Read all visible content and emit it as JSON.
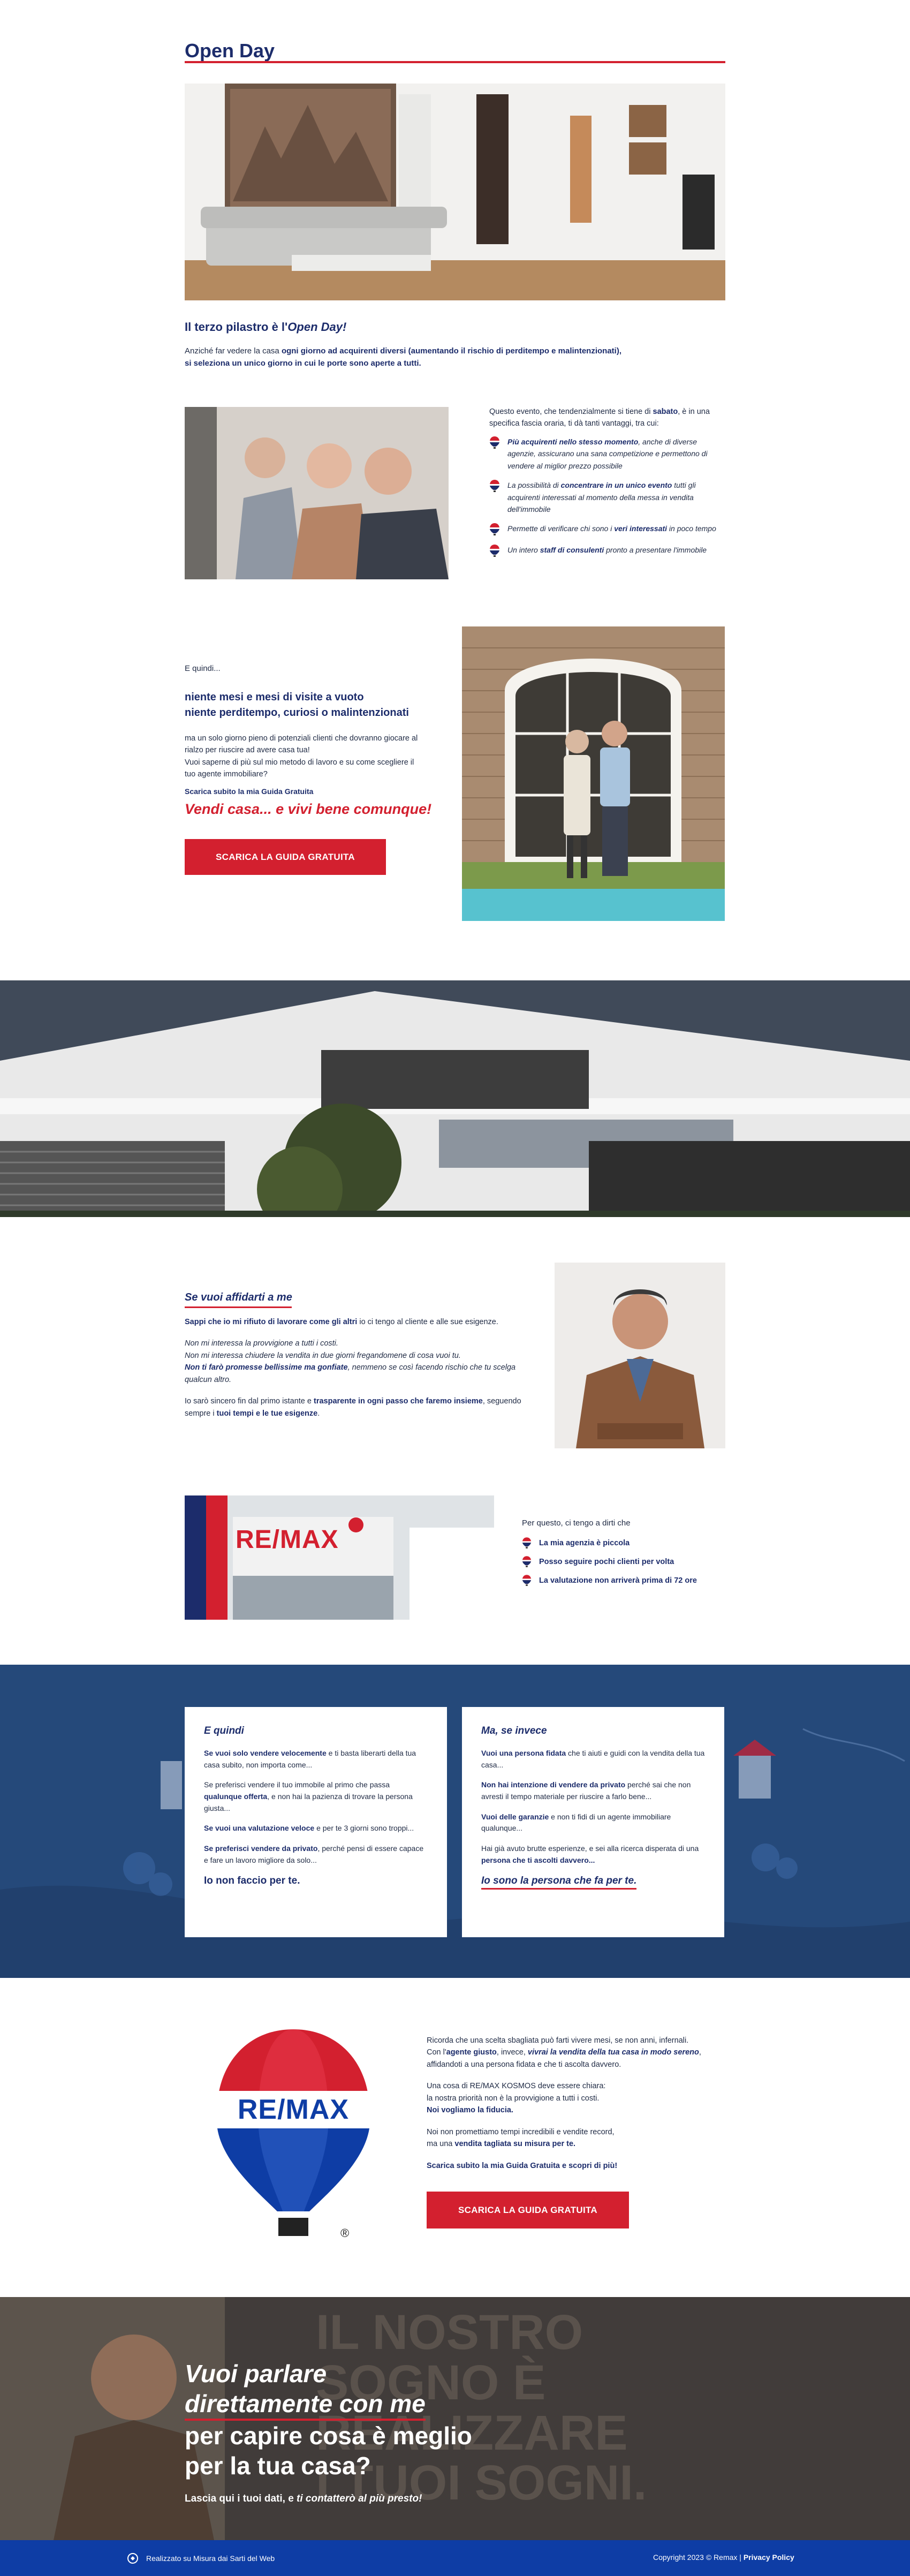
{
  "open_day": {
    "title": "Open Day",
    "pillar_title_a": "Il terzo pilastro è l'",
    "pillar_title_b": "Open Day!",
    "pillar_text_a": "Anziché far vedere la casa ",
    "pillar_text_b": "ogni giorno ad acquirenti diversi (aumentando il rischio di perditempo e malintenzionati),",
    "pillar_text_c": "si seleziona un unico giorno in cui le porte sono aperte a tutti."
  },
  "advantages": {
    "intro_a": "Questo evento, che tendenzialmente si tiene di ",
    "intro_b": "sabato",
    "intro_c": ", è in una specifica fascia oraria, ti dà tanti vantaggi, tra cui:",
    "items": [
      {
        "strong": "Più acquirenti nello stesso momento",
        "rest": ", anche di diverse agenzie, assicurano una sana competizione e permettono di vendere al miglior prezzo possibile"
      },
      {
        "lead": "La possibilità di ",
        "strong": "concentrare in un unico evento",
        "rest": " tutti gli acquirenti interessati al momento della messa in vendita dell'immobile"
      },
      {
        "lead": "Permette di verificare chi sono i ",
        "strong": "veri interessati",
        "rest": " in poco tempo"
      },
      {
        "lead": "Un intero ",
        "strong": "staff di consulenti",
        "rest": " pronto a presentare l'immobile"
      }
    ]
  },
  "months": {
    "quindi": "E quindi...",
    "head_1": "niente mesi e mesi di visite a vuoto",
    "head_2": "niente perditempo, curiosi o malintenzionati",
    "body_1": "ma un solo giorno pieno di potenziali clienti che dovranno giocare al rialzo per riuscire ad avere casa tua!",
    "body_2": "Vuoi saperne di più sul mio metodo di lavoro e su come scegliere il tuo agente immobiliare?",
    "download_note": "Scarica subito la mia Guida Gratuita",
    "slogan": "Vendi casa... e vivi bene comunque!",
    "button": "SCARICA LA GUIDA GRATUITA"
  },
  "affidarti": {
    "title": "Se vuoi affidarti a me",
    "p1_a": "Sappi che io mi rifiuto di lavorare come gli altri",
    "p1_b": " io ci tengo al cliente e alle sue esigenze.",
    "p2_1": "Non mi interessa la provvigione a tutti i costi.",
    "p2_2": "Non mi interessa chiudere la vendita in due giorni fregandomene di cosa vuoi tu.",
    "p2_3a": "Non ti farò promesse bellissime ma gonfiate",
    "p2_3b": ", nemmeno se così facendo rischio che tu scelga qualcun altro.",
    "p3_a": "Io sarò sincero fin dal primo istante e ",
    "p3_b": "trasparente in ogni passo che faremo insieme",
    "p3_c": ", seguendo sempre i ",
    "p3_d": "tuoi tempi e le tue esigenze",
    "p3_e": "."
  },
  "remax_row": {
    "sign": "RE/MAX",
    "intro": "Per questo, ci tengo a dirti che",
    "items": [
      "La mia agenzia è piccola",
      "Posso seguire pochi clienti per volta",
      "La valutazione non arriverà prima di 72 ore"
    ]
  },
  "cards": {
    "left": {
      "title": "E quindi",
      "p1_a": "Se vuoi solo vendere velocemente",
      "p1_b": " e ti basta liberarti della tua casa subito, non importa come...",
      "p2_a": "Se preferisci vendere il tuo immobile al primo che passa ",
      "p2_b": "qualunque offerta",
      "p2_c": ", e non hai la pazienza di trovare la persona giusta...",
      "p3_a": "Se vuoi una valutazione veloce",
      "p3_b": " e per te 3 giorni sono troppi...",
      "p4_a": "Se preferisci vendere da privato",
      "p4_b": ", perché pensi di essere capace e fare un lavoro migliore da solo...",
      "final": "Io non faccio per te."
    },
    "right": {
      "title": "Ma, se invece",
      "p1_a": "Vuoi una persona fidata",
      "p1_b": " che ti aiuti e guidi con la vendita della tua casa...",
      "p2_a": "Non hai intenzione di vendere da privato",
      "p2_b": " perché sai che non avresti il tempo materiale per riuscire a farlo bene...",
      "p3_a": "Vuoi delle garanzie",
      "p3_b": " e non ti fidi di un agente immobiliare qualunque...",
      "p4_a": "Hai già avuto brutte esperienze, e sei alla ricerca disperata di una ",
      "p4_b": "persona che ti ascolti davvero...",
      "final": "Io sono la persona che fa per te."
    }
  },
  "balloon_section": {
    "logo": "RE/MAX",
    "registered": "®",
    "p1_a": "Ricorda che una scelta sbagliata può farti vivere mesi, se non anni, infernali.",
    "p1_b": "Con l'",
    "p1_c": "agente giusto",
    "p1_d": ", invece, ",
    "p1_e": "vivrai la vendita della tua casa in modo sereno",
    "p1_f": ", affidandoti a una persona fidata e che ti ascolta davvero.",
    "p2_a": "Una cosa di RE/MAX KOSMOS deve essere chiara:",
    "p2_b": "la nostra priorità non è la provvigione a tutti i costi.",
    "p2_c": "Noi vogliamo la fiducia.",
    "p3_a": "Noi non promettiamo tempi incredibili e vendite record,",
    "p3_b": "ma una ",
    "p3_c": "vendita tagliata su misura per te.",
    "p4": "Scarica subito la mia Guida Gratuita e scopri di più!",
    "button": "SCARICA LA GUIDA GRATUITA"
  },
  "contact": {
    "bg_text_1": "IL NOSTRO",
    "bg_text_2": "SOGNO È",
    "bg_text_3": "REALIZZARE",
    "bg_text_4": "I TUOI SOGNI.",
    "line1": "Vuoi parlare",
    "line2": "direttamente con me",
    "line3": "per capire cosa è meglio",
    "line4": "per la tua casa?",
    "sub_a": "Lascia qui i tuoi dati, e ",
    "sub_b": "ti contatterò al più presto!"
  },
  "footer": {
    "left": "Realizzato su Misura dai Sarti del Web",
    "right_a": "Copyright 2023 © Remax | ",
    "right_b": "Privacy Policy"
  },
  "colors": {
    "navy": "#1c2c6b",
    "red": "#d3202f",
    "footer_blue": "#0e3da5",
    "band_blue": "#25497a"
  }
}
